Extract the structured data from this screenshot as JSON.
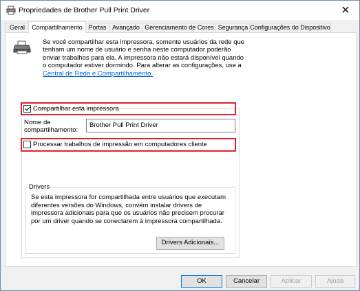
{
  "window": {
    "title": "Propriedades de Brother Pull Print Driver"
  },
  "tabs": [
    {
      "label": "Geral"
    },
    {
      "label": "Compartilhamento"
    },
    {
      "label": "Portas"
    },
    {
      "label": "Avançado"
    },
    {
      "label": "Gerenciamento de Cores"
    },
    {
      "label": "Segurança"
    },
    {
      "label": "Configurações do Dispositivo"
    }
  ],
  "active_tab": "Compartilhamento",
  "sharing": {
    "description_lines": [
      "Se você compartilhar esta impressora, somente usuários da rede que",
      "tenham um nome de usuário e senha neste computador poderão",
      "enviar trabalhos para ela. A impressora não estará disponível quando",
      "o computador estiver dormindo. Para alterar as configurações, use a"
    ],
    "link_text": "Central de Rede e Compartilhamento.",
    "share_checkbox_label": "Compartilhar esta impressora",
    "share_checked": true,
    "share_name_label_line1": "Nome de",
    "share_name_label_line2": "compartilhamento:",
    "share_name_value": "Brother Pull Print Driver",
    "render_jobs_label": "Processar trabalhos de impressão em computadores cliente",
    "render_jobs_checked": false
  },
  "drivers": {
    "title": "Drivers",
    "text_lines": [
      "Se esta impressora for compartilhada entre usuários que executam",
      "diferentes versões do Windows, convém instalar drivers de",
      "impressora adicionais para que os usuários não precisem procurar",
      "por um driver quando se conectarem à impressora compartilhada."
    ],
    "additional_drivers_button": "Drivers Adicionais..."
  },
  "footer": {
    "ok": "OK",
    "cancel": "Cancelar",
    "apply": "Aplicar",
    "help": "Ajuda"
  },
  "colors": {
    "highlight_border": "#e0202a",
    "link": "#0066cc",
    "primary_border": "#0078d7"
  },
  "icons": {
    "title": "printer-icon",
    "close": "close-icon",
    "panel": "printer-icon"
  }
}
